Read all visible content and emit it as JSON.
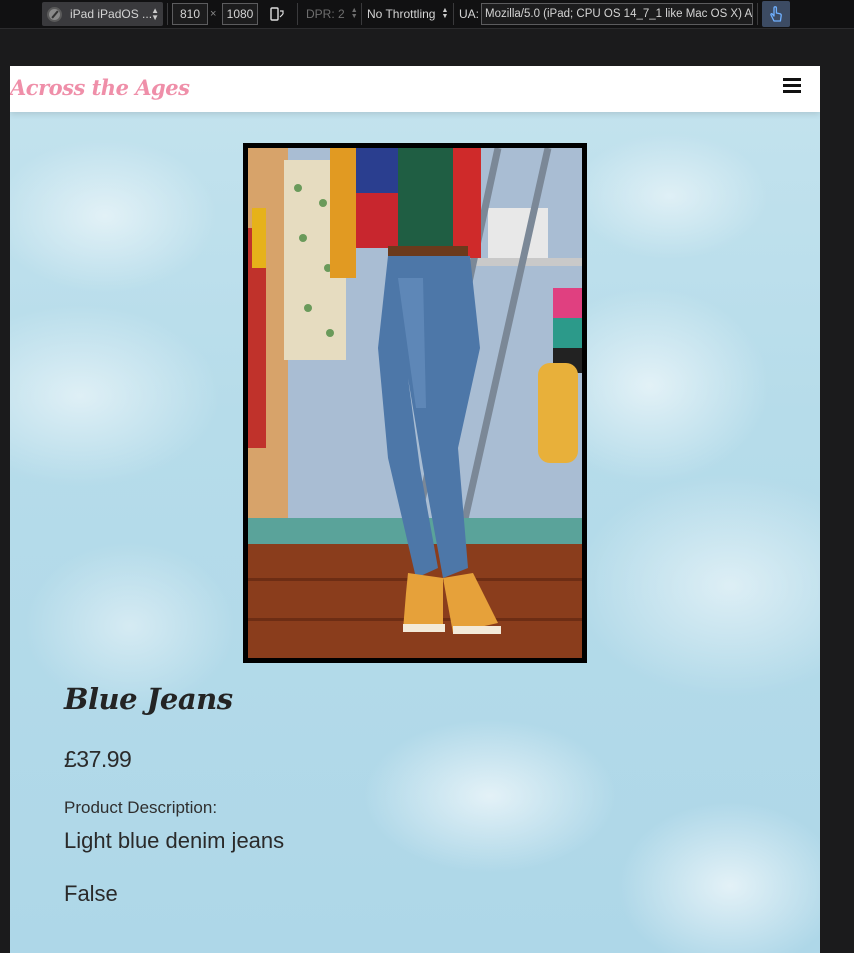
{
  "devtools": {
    "device": "iPad iPadOS ...",
    "width": "810",
    "times": "×",
    "height": "1080",
    "dpr": "DPR: 2",
    "throttling": "No Throttling",
    "ua_label": "UA:",
    "ua_value": "Mozilla/5.0 (iPad; CPU OS 14_7_1 like Mac OS X) Ap"
  },
  "site": {
    "brand": "Across the Ages",
    "menu_icon": "hamburger-menu-icon"
  },
  "product": {
    "image_alt": "Person wearing light blue high-waisted jeans",
    "title": "Blue Jeans",
    "price": "£37.99",
    "description_label": "Product Description:",
    "description": "Light blue denim jeans",
    "stock": "False"
  },
  "colors": {
    "brand_pink": "#ef8fa9",
    "sky": "#b6dcea",
    "text_dark": "#242424",
    "devtools_bg": "#111112"
  }
}
